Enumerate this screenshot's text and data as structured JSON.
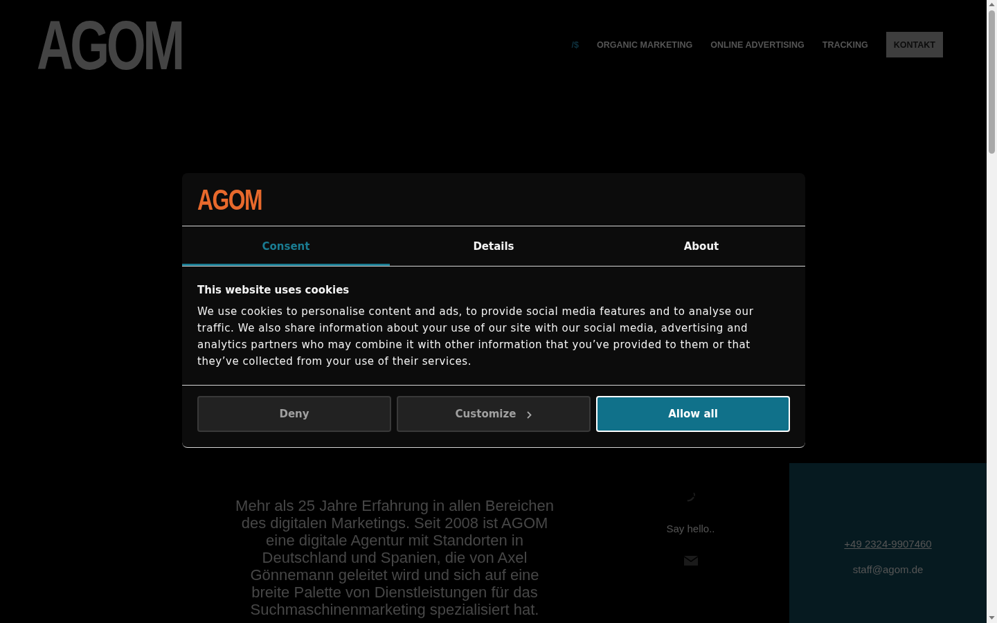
{
  "header": {
    "logo": "AGOM",
    "nav": [
      {
        "label": "/$",
        "kind": "symbol"
      },
      {
        "label": "ORGANIC MARKETING",
        "kind": "link"
      },
      {
        "label": "ONLINE ADVERTISING",
        "kind": "link"
      },
      {
        "label": "TRACKING",
        "kind": "link"
      },
      {
        "label": "KONTAKT",
        "kind": "button"
      }
    ]
  },
  "cookie_dialog": {
    "logo": "AGOM",
    "tabs": [
      {
        "label": "Consent",
        "selected": true
      },
      {
        "label": "Details",
        "selected": false
      },
      {
        "label": "About",
        "selected": false
      }
    ],
    "heading": "This website uses cookies",
    "text": "We use cookies to personalise content and ads, to provide social media features and to analyse our traffic. We also share information about your use of our site with our social media, advertising and analytics partners who may combine it with other information that you’ve provided to them or that they’ve collected from your use of their services.",
    "buttons": [
      {
        "label": "Deny",
        "kind": "secondary"
      },
      {
        "label": "Customize",
        "kind": "more"
      },
      {
        "label": "Allow all",
        "kind": "primary"
      }
    ]
  },
  "intro": {
    "text": "Mehr als 25 Jahre Erfahrung in allen Bereichen des digitalen Marketings. Seit 2008 ist AGOM eine digitale Agentur mit Standorten in Deutschland und Spanien, die von Axel Gönnemann geleitet wird und sich auf eine breite Palette von Dienstleistungen für das Suchmaschinenmarketing spezialisiert hat."
  },
  "contact": {
    "label": "Say hello.."
  },
  "contact_panel": {
    "phone": "+49 2324-9907460",
    "email": "staff@agom.de"
  }
}
